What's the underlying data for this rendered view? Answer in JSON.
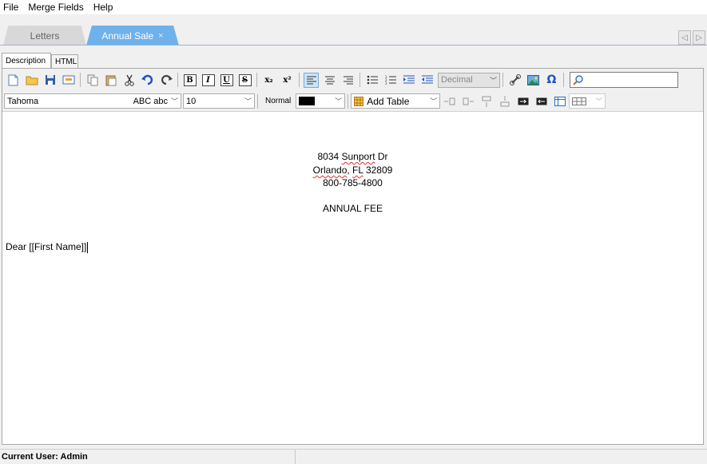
{
  "menu": {
    "items": [
      "File",
      "Merge Fields",
      "Help"
    ]
  },
  "tabs": [
    {
      "label": "Letters",
      "active": false
    },
    {
      "label": "Annual Sale",
      "active": true,
      "close": "×"
    }
  ],
  "subtabs": [
    "Description",
    "HTML"
  ],
  "toolbar": {
    "bold": "B",
    "italic": "I",
    "underline": "U",
    "strike": "S",
    "subscript": "x₂",
    "superscript": "x²",
    "list_style": "Decimal",
    "omega": "Ω",
    "search_placeholder": ""
  },
  "format_bar": {
    "font": "Tahoma",
    "font_preview": "ABC abc",
    "size": "10",
    "style": "Normal",
    "color": "#000000",
    "add_table": "Add Table"
  },
  "document": {
    "address_line1_a": "8034 ",
    "address_line1_b": "Sunport",
    "address_line1_c": " Dr",
    "address_line2_a": "Orlando",
    "address_line2_b": ", ",
    "address_line2_c": "FL",
    "address_line2_d": " 32809",
    "phone": "800-785-4800",
    "heading": "ANNUAL FEE",
    "greeting": "Dear [[First Name]]"
  },
  "status": {
    "user": "Current User: Admin"
  },
  "colors": {
    "active_tab": "#6fb1ea",
    "spell_error": "#e03030"
  }
}
